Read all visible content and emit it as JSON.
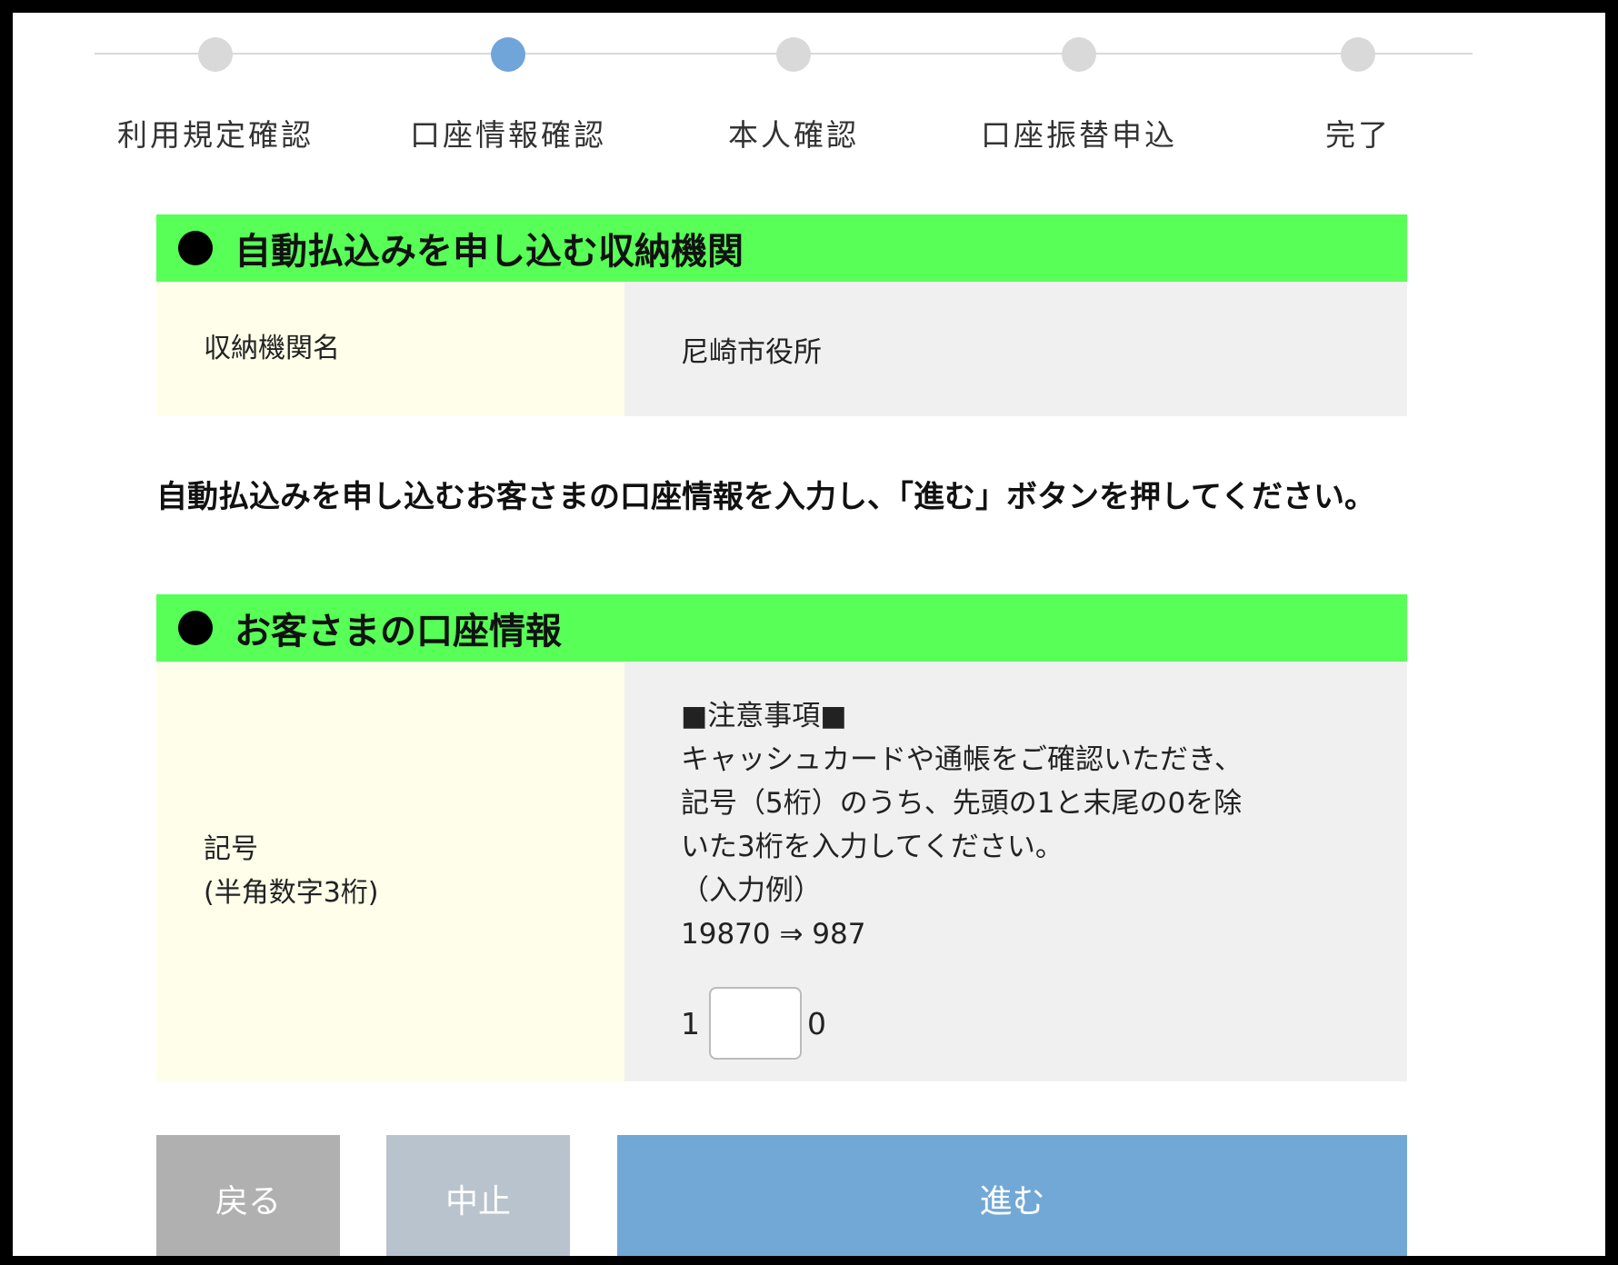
{
  "stepper": {
    "steps": [
      {
        "label": "利用規定確認",
        "active": false
      },
      {
        "label": "口座情報確認",
        "active": true
      },
      {
        "label": "本人確認",
        "active": false
      },
      {
        "label": "口座振替申込",
        "active": false
      },
      {
        "label": "完了",
        "active": false
      }
    ]
  },
  "institution_section": {
    "title": "自動払込みを申し込む収納機関",
    "field_label": "収納機関名",
    "field_value": "尼崎市役所"
  },
  "instruction": "自動払込みを申し込むお客さまの口座情報を入力し、「進む」ボタンを押してください。",
  "account_section": {
    "title": "お客さまの口座情報",
    "field_label_line1": "記号",
    "field_label_line2": "(半角数字3桁)",
    "notes": [
      "■注意事項■",
      "キャッシュカードや通帳をご確認いただき、",
      "記号（5桁）のうち、先頭の1と末尾の0を除",
      "いた3桁を入力してください。",
      "（入力例）",
      "19870 ⇒ 987"
    ],
    "code_prefix": "1",
    "code_suffix": "0",
    "code_value": ""
  },
  "buttons": {
    "back": "戻る",
    "cancel": "中止",
    "next": "進む"
  },
  "colors": {
    "section_header": "#57ff57",
    "active_step": "#6fa5d8",
    "next_button": "#72a8d6"
  }
}
